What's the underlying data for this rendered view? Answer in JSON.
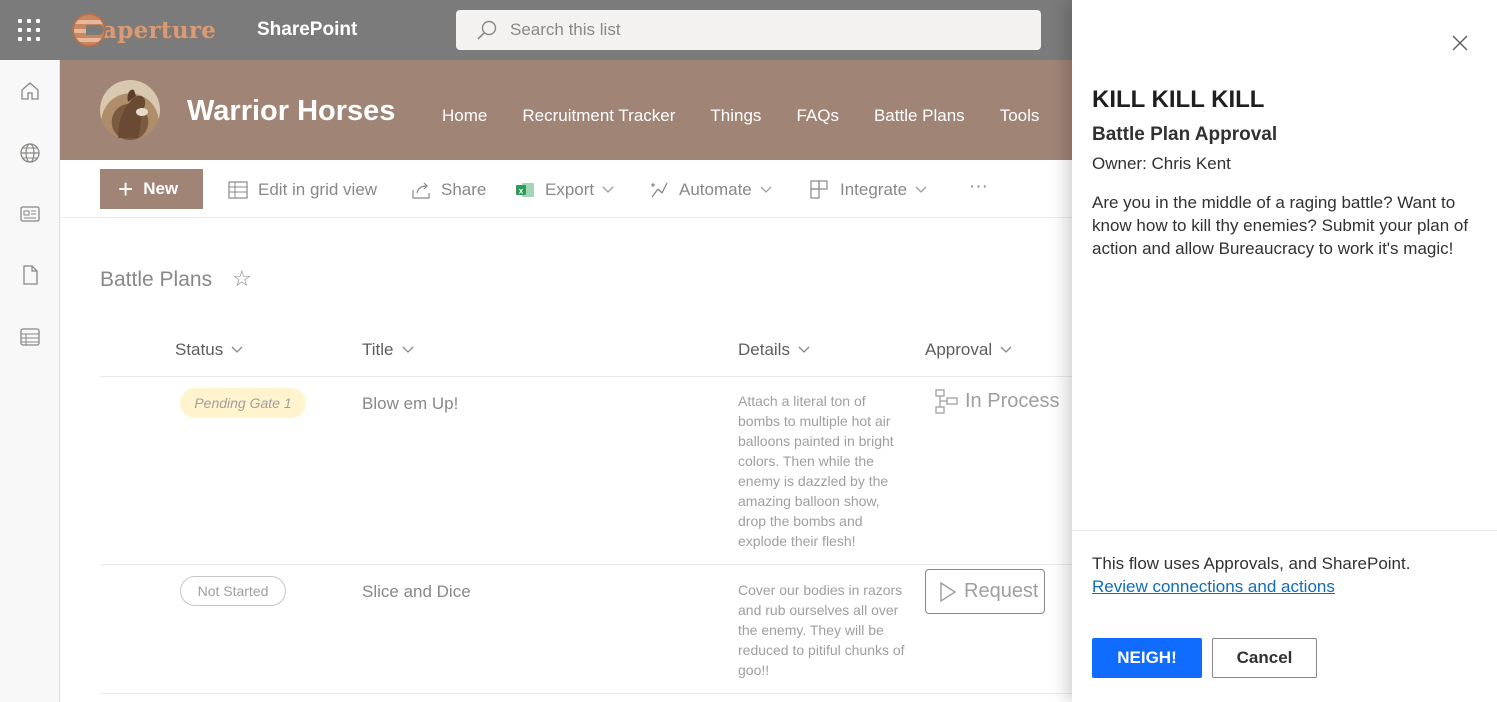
{
  "suite_bar": {
    "logo_text": "aperture",
    "app_name": "SharePoint",
    "search_placeholder": "Search this list"
  },
  "site": {
    "title": "Warrior Horses",
    "nav": [
      "Home",
      "Recruitment Tracker",
      "Things",
      "FAQs",
      "Battle Plans",
      "Tools"
    ]
  },
  "command_bar": {
    "new_label": "New",
    "edit_grid": "Edit in grid view",
    "share": "Share",
    "export": "Export",
    "automate": "Automate",
    "integrate": "Integrate",
    "more": "···"
  },
  "list": {
    "title": "Battle Plans",
    "columns": [
      "Status",
      "Title",
      "Details",
      "Approval"
    ],
    "rows": [
      {
        "status": "Pending Gate 1",
        "title": "Blow em Up!",
        "details": "Attach a literal ton of bombs to multiple hot air balloons painted in bright colors. Then while the enemy is dazzled by the amazing balloon show, drop the bombs and explode their flesh!",
        "approval": "In Process"
      },
      {
        "status": "Not Started",
        "title": "Slice and Dice",
        "details": "Cover our bodies in razors and rub ourselves all over the enemy. They will be reduced to pitiful chunks of goo!!",
        "approval": "Request"
      }
    ]
  },
  "panel": {
    "title": "KILL KILL KILL",
    "subtitle": "Battle Plan Approval",
    "owner": "Owner: Chris Kent",
    "description": "Are you in the middle of a raging battle? Want to know how to kill thy enemies? Submit your plan of action and allow Bureaucracy to work it's magic!",
    "flow_text": "This flow uses Approvals, and SharePoint.",
    "review_link": "Review connections and actions",
    "confirm_label": "NEIGH!",
    "cancel_label": "Cancel"
  },
  "colors": {
    "suite_bar": "#7b7b7b",
    "site_header": "#a08476",
    "primary_button": "#0f6cff",
    "link": "#0f6cbd",
    "pending_pill": "#fff4ce"
  }
}
